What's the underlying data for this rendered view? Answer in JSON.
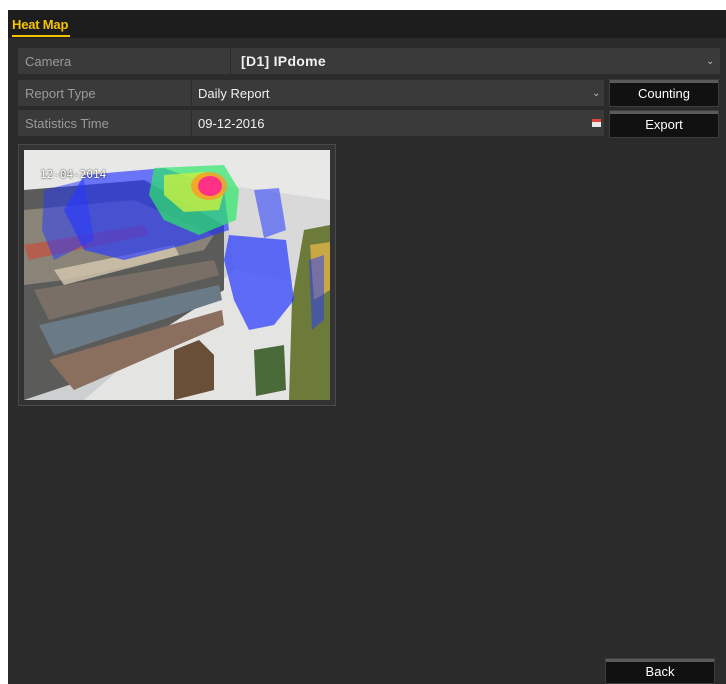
{
  "tab": {
    "label": "Heat Map"
  },
  "camera": {
    "label": "Camera",
    "value": "[D1] IPdome"
  },
  "report_type": {
    "label": "Report Type",
    "value": "Daily Report"
  },
  "statistics_time": {
    "label": "Statistics Time",
    "value": "09-12-2016"
  },
  "buttons": {
    "counting": "Counting",
    "export": "Export",
    "back": "Back"
  },
  "snapshot": {
    "osd_text": "12-04-2014"
  },
  "icons": {
    "dropdown": "chevron-down-icon",
    "calendar": "calendar-icon"
  },
  "colors": {
    "accent": "#f5c400",
    "panel": "#2b2b2b",
    "field": "#3a3a3a"
  }
}
